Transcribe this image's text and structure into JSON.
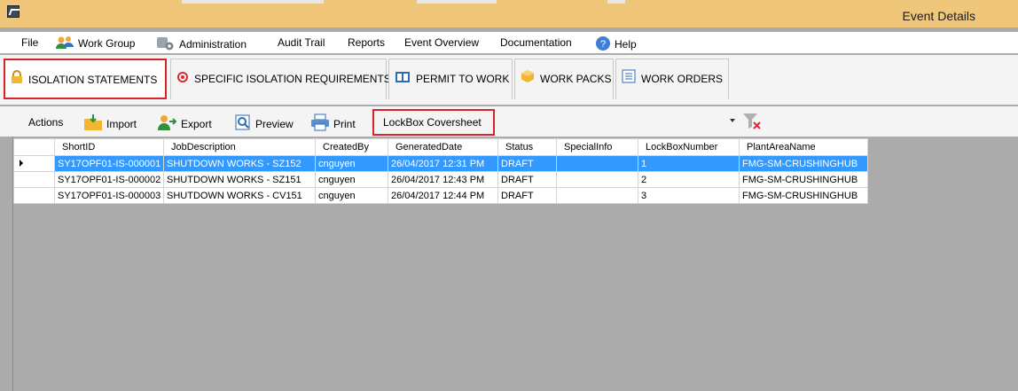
{
  "window": {
    "title": "Event Details"
  },
  "menu": {
    "file": "File",
    "work_group": "Work Group",
    "administration": "Administration",
    "audit_trail": "Audit Trail",
    "reports": "Reports",
    "event_overview": "Event Overview",
    "documentation": "Documentation",
    "help": "Help"
  },
  "tabs": [
    {
      "label": "ISOLATION STATEMENTS",
      "icon": "lock-icon",
      "active": true
    },
    {
      "label": "SPECIFIC ISOLATION REQUIREMENTS",
      "icon": "target-icon"
    },
    {
      "label": "PERMIT TO WORK",
      "icon": "book-icon"
    },
    {
      "label": "WORK PACKS",
      "icon": "box-icon"
    },
    {
      "label": "WORK ORDERS",
      "icon": "list-icon"
    }
  ],
  "toolbar": {
    "actions": "Actions",
    "import": "Import",
    "export": "Export",
    "preview": "Preview",
    "print": "Print",
    "lockbox": "LockBox Coversheet",
    "combo_value": ""
  },
  "grid": {
    "columns": [
      "ShortID",
      "JobDescription",
      "CreatedBy",
      "GeneratedDate",
      "Status",
      "SpecialInfo",
      "LockBoxNumber",
      "PlantAreaName"
    ],
    "rows": [
      [
        "SY17OPF01-IS-000001",
        "SHUTDOWN WORKS - SZ152",
        "cnguyen",
        "26/04/2017 12:31 PM",
        "DRAFT",
        "",
        "1",
        "FMG-SM-CRUSHINGHUB"
      ],
      [
        "SY17OPF01-IS-000002",
        "SHUTDOWN WORKS - SZ151",
        "cnguyen",
        "26/04/2017 12:43 PM",
        "DRAFT",
        "",
        "2",
        "FMG-SM-CRUSHINGHUB"
      ],
      [
        "SY17OPF01-IS-000003",
        "SHUTDOWN WORKS - CV151",
        "cnguyen",
        "26/04/2017 12:44 PM",
        "DRAFT",
        "",
        "3",
        "FMG-SM-CRUSHINGHUB"
      ]
    ],
    "selected_row": 0
  },
  "colors": {
    "accent_red": "#d9232b",
    "selection": "#3399ff",
    "titlebar": "#f0c67a",
    "empty_area": "#ababab"
  }
}
